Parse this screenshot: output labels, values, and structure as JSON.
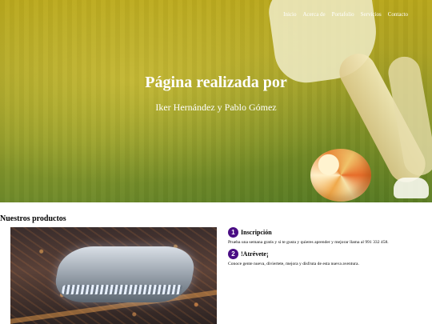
{
  "nav": {
    "items": [
      "Inicio",
      "Acerca de",
      "Portafolio",
      "Servicios",
      "Contacto"
    ]
  },
  "hero": {
    "title": "Página realizada por",
    "subtitle": "Iker Hernández y Pablo Gómez"
  },
  "products": {
    "heading": "Nuestros productos",
    "steps": [
      {
        "number": "1",
        "title": "Inscripción",
        "text": "Prueba una semana gratis y si te gusta y quieres aprender y mejorar llama al 991 332 458."
      },
      {
        "number": "2",
        "title": "!Atrévete¡",
        "text": "Conoce gente nueva, diviertete, mejora y disfruta de esta nueva aventura."
      }
    ]
  },
  "colors": {
    "accent": "#4a0d84",
    "hero_tint": "#b9a71c"
  }
}
